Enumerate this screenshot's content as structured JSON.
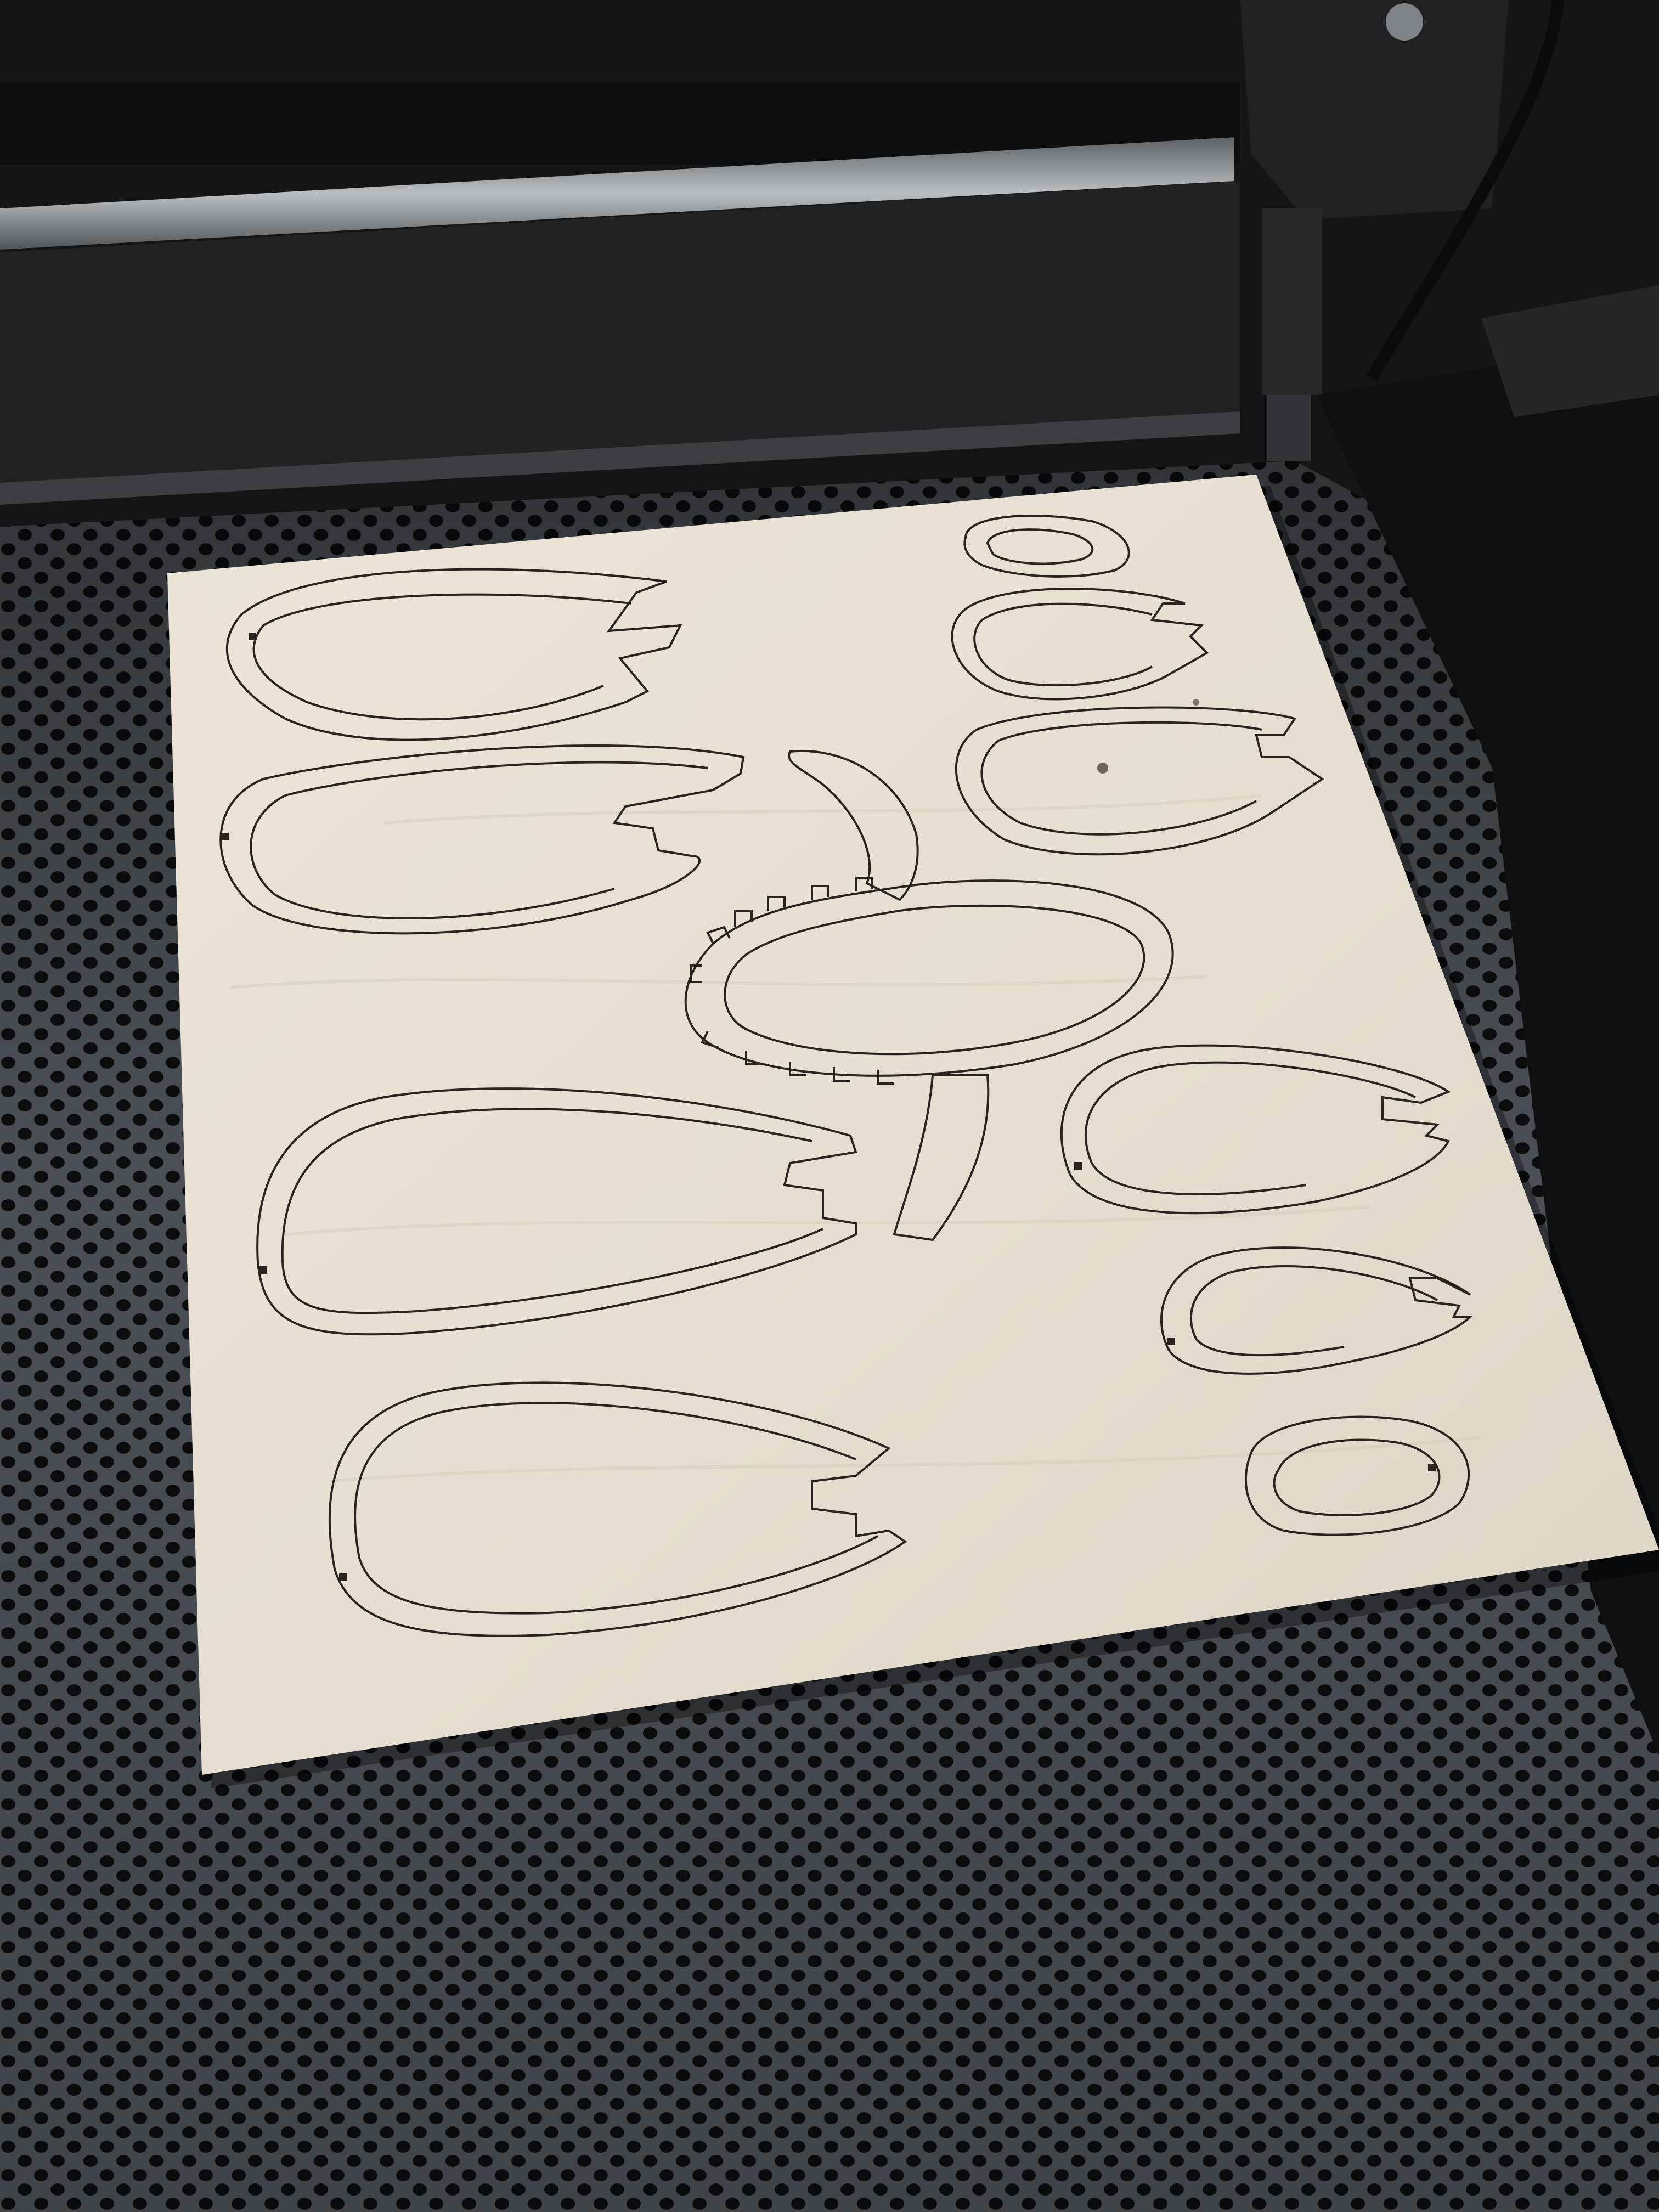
{
  "scene": {
    "subject": "laser-cutter-bed",
    "colors": {
      "machine_frame": "#141517",
      "rail_metal": "#8d9499",
      "honeycomb_hole": "#0c0d0f",
      "honeycomb_mesh": "#4a5056",
      "plywood": "#e8e1d4",
      "plywood_shadow": "#d2c9b9",
      "cut_line": "#2a241e"
    },
    "cut_parts": [
      {
        "kind": "hook-frame",
        "count": 9
      },
      {
        "kind": "oval-gear-frame",
        "count": 1
      },
      {
        "kind": "curved-arm",
        "count": 2
      },
      {
        "kind": "small-oval-ring",
        "count": 1
      }
    ]
  }
}
